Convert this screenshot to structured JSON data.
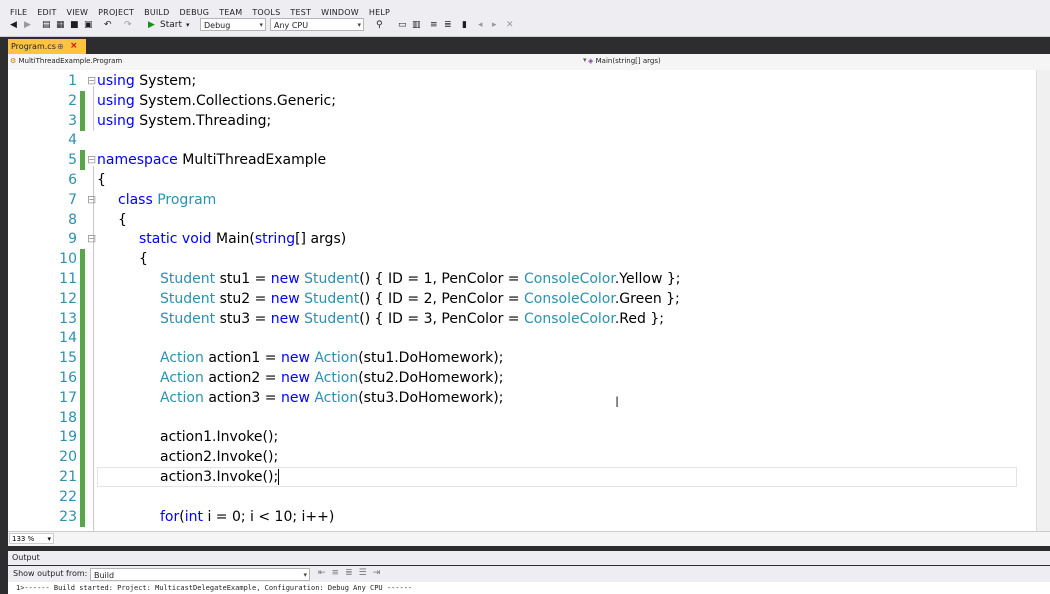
{
  "menu": [
    "FILE",
    "EDIT",
    "VIEW",
    "PROJECT",
    "BUILD",
    "DEBUG",
    "TEAM",
    "TOOLS",
    "TEST",
    "WINDOW",
    "HELP"
  ],
  "toolbar": {
    "start_label": "Start",
    "config_value": "Debug",
    "platform_value": "Any CPU"
  },
  "tab": {
    "title": "Program.cs",
    "pin": "⊕",
    "close": "×"
  },
  "nav": {
    "type_combo": "MultiThreadExample.Program",
    "member_combo": "Main(string[] args)"
  },
  "editor": {
    "zoom": "133 %",
    "lines": [
      {
        "n": "1",
        "indent": 0,
        "code": [
          [
            "kw",
            "using"
          ],
          [
            "",
            "System;"
          ]
        ]
      },
      {
        "n": "2",
        "indent": 0,
        "code": [
          [
            "kw",
            "using"
          ],
          [
            "",
            "System.Collections.Generic;"
          ]
        ]
      },
      {
        "n": "3",
        "indent": 0,
        "code": [
          [
            "kw",
            "using"
          ],
          [
            "",
            "System.Threading;"
          ]
        ]
      },
      {
        "n": "4",
        "indent": 0,
        "code": []
      },
      {
        "n": "5",
        "indent": 0,
        "code": [
          [
            "kw",
            "namespace"
          ],
          [
            "",
            "MultiThreadExample"
          ]
        ]
      },
      {
        "n": "6",
        "indent": 0,
        "code": [
          [
            "",
            "{"
          ]
        ]
      },
      {
        "n": "7",
        "indent": 1,
        "code": [
          [
            "kw",
            "class"
          ],
          [
            "ty",
            "Program"
          ]
        ]
      },
      {
        "n": "8",
        "indent": 1,
        "code": [
          [
            "",
            "{"
          ]
        ]
      },
      {
        "n": "9",
        "indent": 2,
        "code": [
          [
            "kw",
            "static"
          ],
          [
            "kw",
            "void"
          ],
          [
            "",
            "Main("
          ],
          [
            "kw",
            "string"
          ],
          [
            "",
            "[] args)"
          ]
        ]
      },
      {
        "n": "10",
        "indent": 2,
        "code": [
          [
            "",
            "{"
          ]
        ]
      },
      {
        "n": "11",
        "indent": 3,
        "code": [
          [
            "ty",
            "Student"
          ],
          [
            "",
            "stu1 ="
          ],
          [
            "kw",
            "new"
          ],
          [
            "ty",
            "Student"
          ],
          [
            "",
            "() { ID = 1, PenColor ="
          ],
          [
            "ty",
            "ConsoleColor"
          ],
          [
            "",
            ".Yellow };"
          ]
        ]
      },
      {
        "n": "12",
        "indent": 3,
        "code": [
          [
            "ty",
            "Student"
          ],
          [
            "",
            "stu2 ="
          ],
          [
            "kw",
            "new"
          ],
          [
            "ty",
            "Student"
          ],
          [
            "",
            "() { ID = 2, PenColor ="
          ],
          [
            "ty",
            "ConsoleColor"
          ],
          [
            "",
            ".Green };"
          ]
        ]
      },
      {
        "n": "13",
        "indent": 3,
        "code": [
          [
            "ty",
            "Student"
          ],
          [
            "",
            "stu3 ="
          ],
          [
            "kw",
            "new"
          ],
          [
            "ty",
            "Student"
          ],
          [
            "",
            "() { ID = 3, PenColor ="
          ],
          [
            "ty",
            "ConsoleColor"
          ],
          [
            "",
            ".Red };"
          ]
        ]
      },
      {
        "n": "14",
        "indent": 3,
        "code": []
      },
      {
        "n": "15",
        "indent": 3,
        "code": [
          [
            "ty",
            "Action"
          ],
          [
            "",
            "action1 ="
          ],
          [
            "kw",
            "new"
          ],
          [
            "ty",
            "Action"
          ],
          [
            "",
            "(stu1.DoHomework);"
          ]
        ]
      },
      {
        "n": "16",
        "indent": 3,
        "code": [
          [
            "ty",
            "Action"
          ],
          [
            "",
            "action2 ="
          ],
          [
            "kw",
            "new"
          ],
          [
            "ty",
            "Action"
          ],
          [
            "",
            "(stu2.DoHomework);"
          ]
        ]
      },
      {
        "n": "17",
        "indent": 3,
        "code": [
          [
            "ty",
            "Action"
          ],
          [
            "",
            "action3 ="
          ],
          [
            "kw",
            "new"
          ],
          [
            "ty",
            "Action"
          ],
          [
            "",
            "(stu3.DoHomework);"
          ]
        ]
      },
      {
        "n": "18",
        "indent": 3,
        "code": []
      },
      {
        "n": "19",
        "indent": 3,
        "code": [
          [
            "",
            "action1.Invoke();"
          ]
        ]
      },
      {
        "n": "20",
        "indent": 3,
        "code": [
          [
            "",
            "action2.Invoke();"
          ]
        ]
      },
      {
        "n": "21",
        "indent": 3,
        "code": [
          [
            "",
            "action3.Invoke();"
          ]
        ]
      },
      {
        "n": "22",
        "indent": 3,
        "code": []
      },
      {
        "n": "23",
        "indent": 3,
        "code": [
          [
            "kw",
            "for"
          ],
          [
            "",
            "("
          ],
          [
            "kw",
            "int"
          ],
          [
            "",
            "i = 0; i < 10; i++)"
          ]
        ]
      }
    ]
  },
  "output": {
    "title": "Output",
    "show_label": "Show output from:",
    "source": "Build",
    "text": "1>------ Build started: Project: MulticastDelegateExample, Configuration: Debug Any CPU ------"
  }
}
